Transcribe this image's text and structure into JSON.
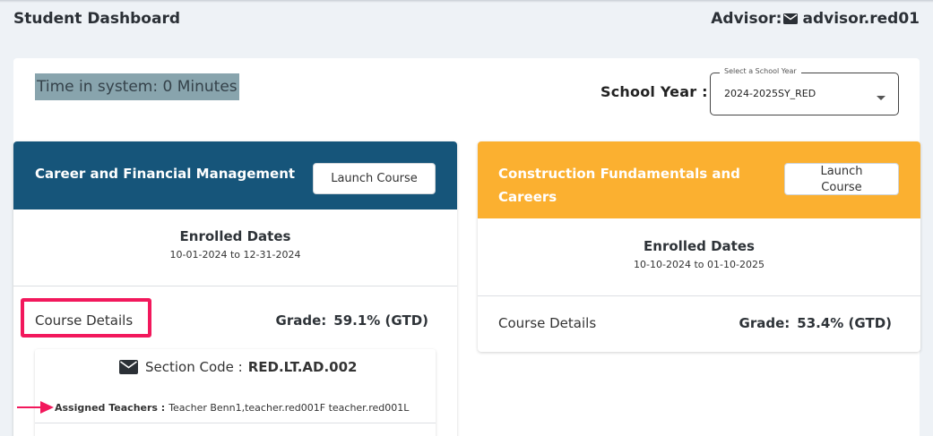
{
  "header": {
    "title": "Student Dashboard",
    "advisor_label": "Advisor:",
    "advisor_name": "advisor.red01"
  },
  "time_in_system": "Time in system: 0 Minutes",
  "school_year": {
    "label": "School Year :",
    "legend": "Select a School Year",
    "selected": "2024-2025SY_RED"
  },
  "courses": [
    {
      "name": "Career and Financial Management",
      "launch_label": "Launch Course",
      "enrolled_title": "Enrolled Dates",
      "enrolled_range": "10-01-2024 to 12-31-2024",
      "details_label": "Course Details",
      "grade_label": "Grade:",
      "grade_value": "59.1% (GTD)",
      "section": {
        "label": "Section Code :",
        "code": "RED.LT.AD.002",
        "teachers_label": "Assigned Teachers :",
        "teachers": "Teacher Benn1,teacher.red001F teacher.red001L"
      }
    },
    {
      "name_line1": "Construction Fundamentals and",
      "name_line2": "Careers",
      "launch_line1": "Launch",
      "launch_line2": "Course",
      "enrolled_title": "Enrolled Dates",
      "enrolled_range": "10-10-2024 to 01-10-2025",
      "details_label": "Course Details",
      "grade_label": "Grade:",
      "grade_value": "53.4% (GTD)"
    }
  ],
  "colors": {
    "course1_header": "#16557a",
    "course2_header": "#fbb030",
    "highlight": "#f2185c",
    "time_highlight": "#88a4ad"
  },
  "icons": {
    "advisor": "mail-icon",
    "section": "mail-icon",
    "pointer": "arrow-right-icon",
    "dropdown": "caret-down-icon"
  }
}
